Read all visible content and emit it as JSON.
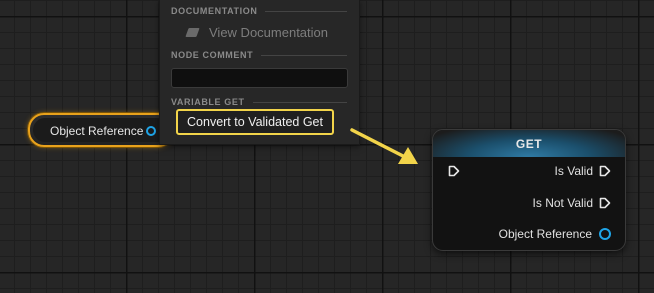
{
  "variable_node": {
    "label": "Object Reference"
  },
  "context_menu": {
    "documentation_header": "DOCUMENTATION",
    "view_documentation": "View Documentation",
    "node_comment_header": "NODE COMMENT",
    "node_comment_value": "",
    "variable_get_header": "VARIABLE GET",
    "convert_label": "Convert to Validated Get"
  },
  "get_node": {
    "title": "GET",
    "pins": {
      "is_valid": "Is Valid",
      "is_not_valid": "Is Not Valid",
      "object_reference": "Object Reference"
    }
  },
  "colors": {
    "selection": "#e9a21c",
    "highlight": "#f2d44a",
    "object_pin": "#1fa5e8",
    "arrow": "#f2d44a"
  }
}
